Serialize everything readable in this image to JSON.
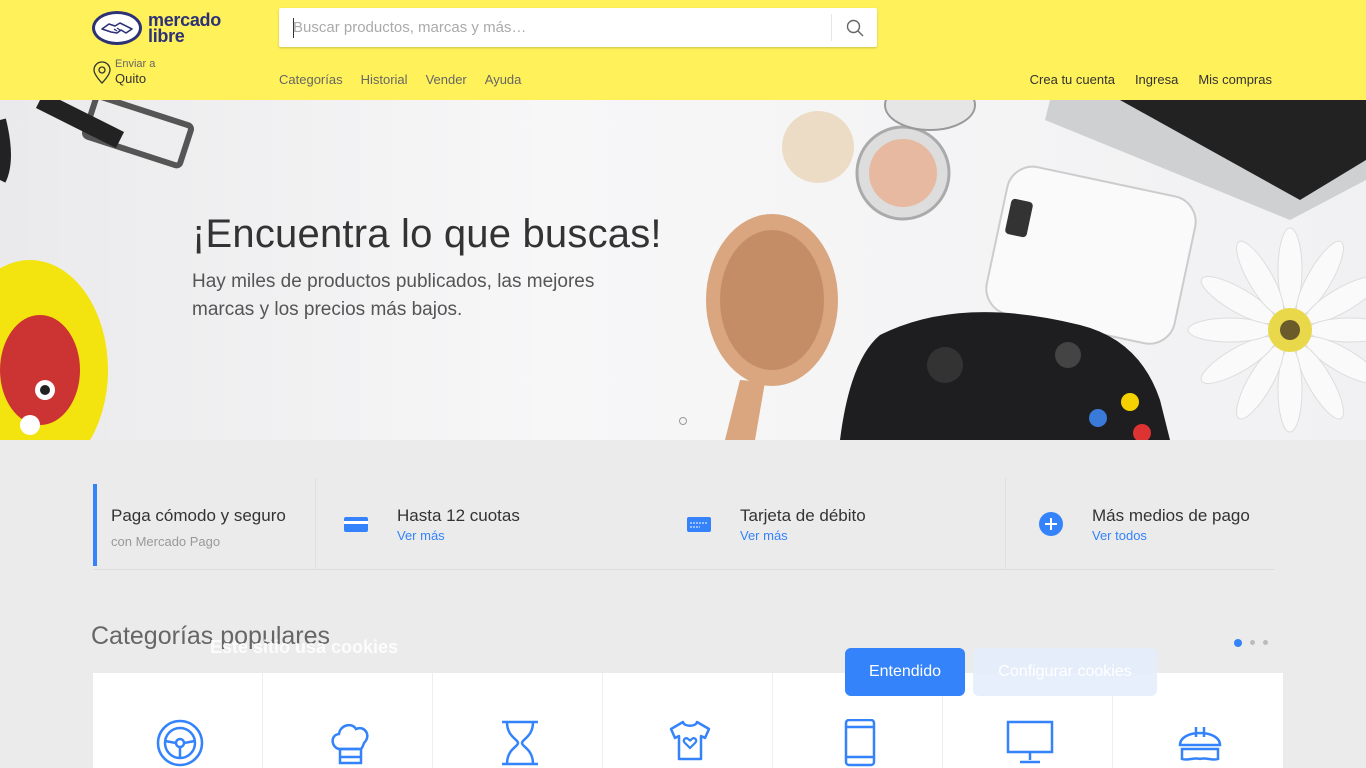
{
  "header": {
    "logo": {
      "line1": "mercado",
      "line2": "libre"
    },
    "search": {
      "placeholder": "Buscar productos, marcas y más…"
    },
    "location": {
      "label": "Enviar a",
      "city": "Quito"
    },
    "nav": [
      "Categorías",
      "Historial",
      "Vender",
      "Ayuda"
    ],
    "user_nav": [
      "Crea tu cuenta",
      "Ingresa",
      "Mis compras"
    ]
  },
  "hero": {
    "title": "¡Encuentra lo que buscas!",
    "subtitle": "Hay miles de productos publicados, las mejores marcas y los precios más bajos."
  },
  "payments": {
    "first": {
      "title": "Paga cómodo y seguro",
      "subtitle": "con Mercado Pago"
    },
    "items": [
      {
        "title": "Hasta 12 cuotas",
        "link": "Ver más",
        "icon": "credit-card-icon"
      },
      {
        "title": "Tarjeta de débito",
        "link": "Ver más",
        "icon": "debit-card-icon"
      },
      {
        "title": "Más medios de pago",
        "link": "Ver todos",
        "icon": "plus-circle-icon"
      }
    ]
  },
  "categories": {
    "title": "Categorías populares",
    "icons": [
      "steering-wheel-icon",
      "chef-hat-icon",
      "hourglass-icon",
      "baby-onesie-icon",
      "smartphone-icon",
      "monitor-icon",
      "safety-helmet-icon"
    ]
  },
  "cookies": {
    "title": "Este sitio usa cookies",
    "accept": "Entendido",
    "configure": "Configurar cookies"
  },
  "colors": {
    "brand_yellow": "#fff159",
    "accent_blue": "#3483fa",
    "logo_navy": "#2d3277"
  }
}
